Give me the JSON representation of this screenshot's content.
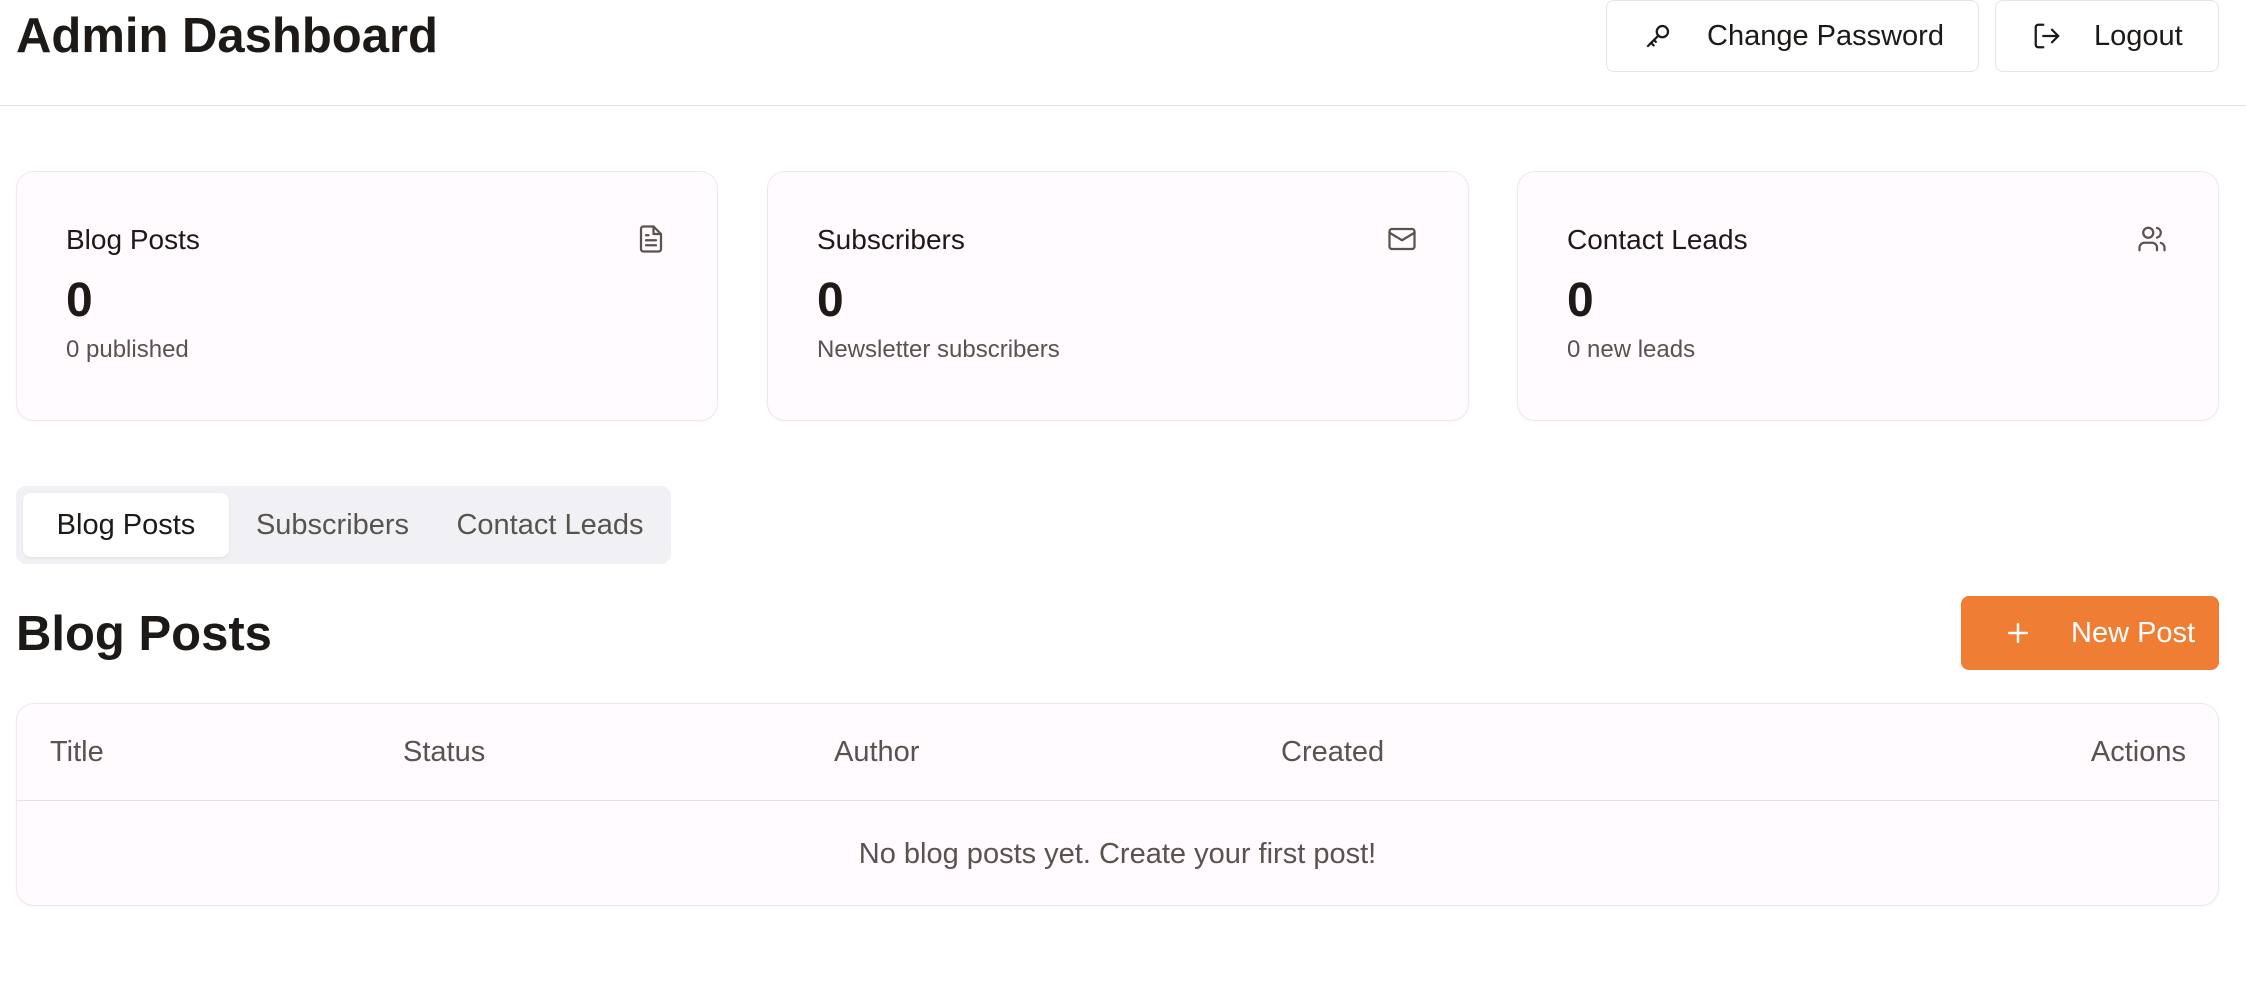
{
  "header": {
    "title": "Admin Dashboard",
    "change_password_label": "Change Password",
    "logout_label": "Logout",
    "change_password_icon": "key-icon",
    "logout_icon": "logout-icon"
  },
  "stats": [
    {
      "title": "Blog Posts",
      "value": "0",
      "sub": "0 published",
      "icon": "document-icon"
    },
    {
      "title": "Subscribers",
      "value": "0",
      "sub": "Newsletter subscribers",
      "icon": "mail-icon"
    },
    {
      "title": "Contact Leads",
      "value": "0",
      "sub": "0 new leads",
      "icon": "users-icon"
    }
  ],
  "tabs": [
    {
      "label": "Blog Posts",
      "active": true
    },
    {
      "label": "Subscribers",
      "active": false
    },
    {
      "label": "Contact Leads",
      "active": false
    }
  ],
  "section": {
    "title": "Blog Posts",
    "new_post_label": "New Post"
  },
  "table": {
    "columns": [
      "Title",
      "Status",
      "Author",
      "Created",
      "Actions"
    ],
    "empty_message": "No blog posts yet. Create your first post!"
  },
  "colors": {
    "accent": "#ef7d34",
    "card_bg": "#fffbfe",
    "tab_bg": "#f1f0f5"
  }
}
